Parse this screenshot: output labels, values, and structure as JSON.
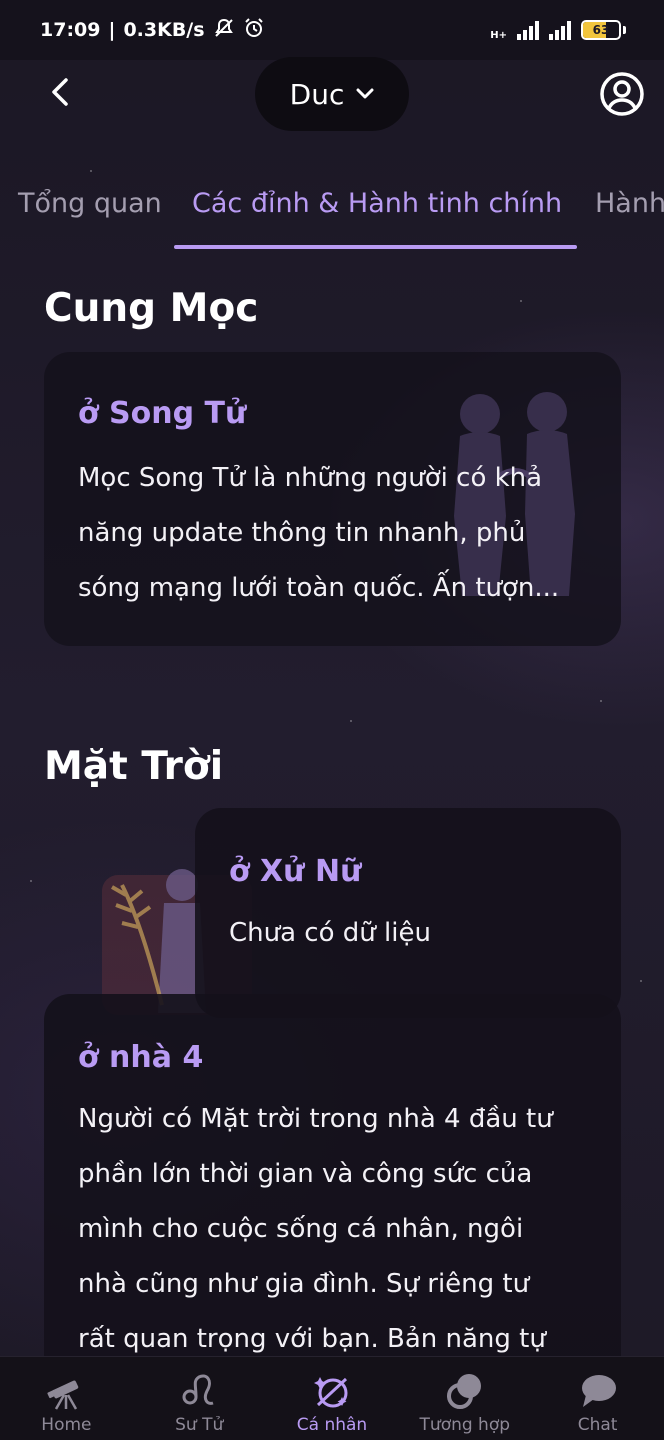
{
  "status_bar": {
    "time": "17:09",
    "speed": "0.3KB/s",
    "battery_level": "63",
    "battery_fraction": 0.63,
    "network_label": "H+"
  },
  "header": {
    "profile_name": "Duc",
    "back_icon": "chevron-left-icon",
    "account_icon": "user-circle-icon"
  },
  "tabs": [
    {
      "label": "Tổng quan"
    },
    {
      "label": "Các đỉnh & Hành tinh chính"
    },
    {
      "label": "Hành"
    }
  ],
  "sections": {
    "ascendant": {
      "title": "Cung Mọc",
      "sign_label": "ở Song Tử",
      "text_lines": [
        "Mọc Song Tử là những người có khả",
        "năng update thông tin nhanh, phủ",
        "sóng mạng lưới toàn quốc. Ấn tượn..."
      ]
    },
    "sun": {
      "title": "Mặt Trời",
      "sign_label": "ở Xử Nữ",
      "sign_text": "Chưa có dữ liệu",
      "house_label": "ở nhà 4",
      "house_text_lines": [
        "Người có Mặt trời trong nhà 4 đầu tư",
        "phần lớn thời gian và công sức của",
        "mình cho cuộc sống cá nhân, ngôi",
        "nhà cũng như gia đình. Sự riêng tư",
        "rất quan trọng với bạn. Bản năng tự"
      ]
    }
  },
  "bottom_nav": [
    {
      "label": "Home",
      "icon": "telescope-icon"
    },
    {
      "label": "Sư Tử",
      "icon": "leo-icon"
    },
    {
      "label": "Cá nhân",
      "icon": "personal-chart-icon"
    },
    {
      "label": "Tương hợp",
      "icon": "compatibility-icon"
    },
    {
      "label": "Chat",
      "icon": "chat-bubble-icon"
    }
  ],
  "colors": {
    "accent": "#b99bf3",
    "background": "#1c1825",
    "card": "#14111b",
    "text": "#ffffff",
    "muted": "#8e8997"
  }
}
